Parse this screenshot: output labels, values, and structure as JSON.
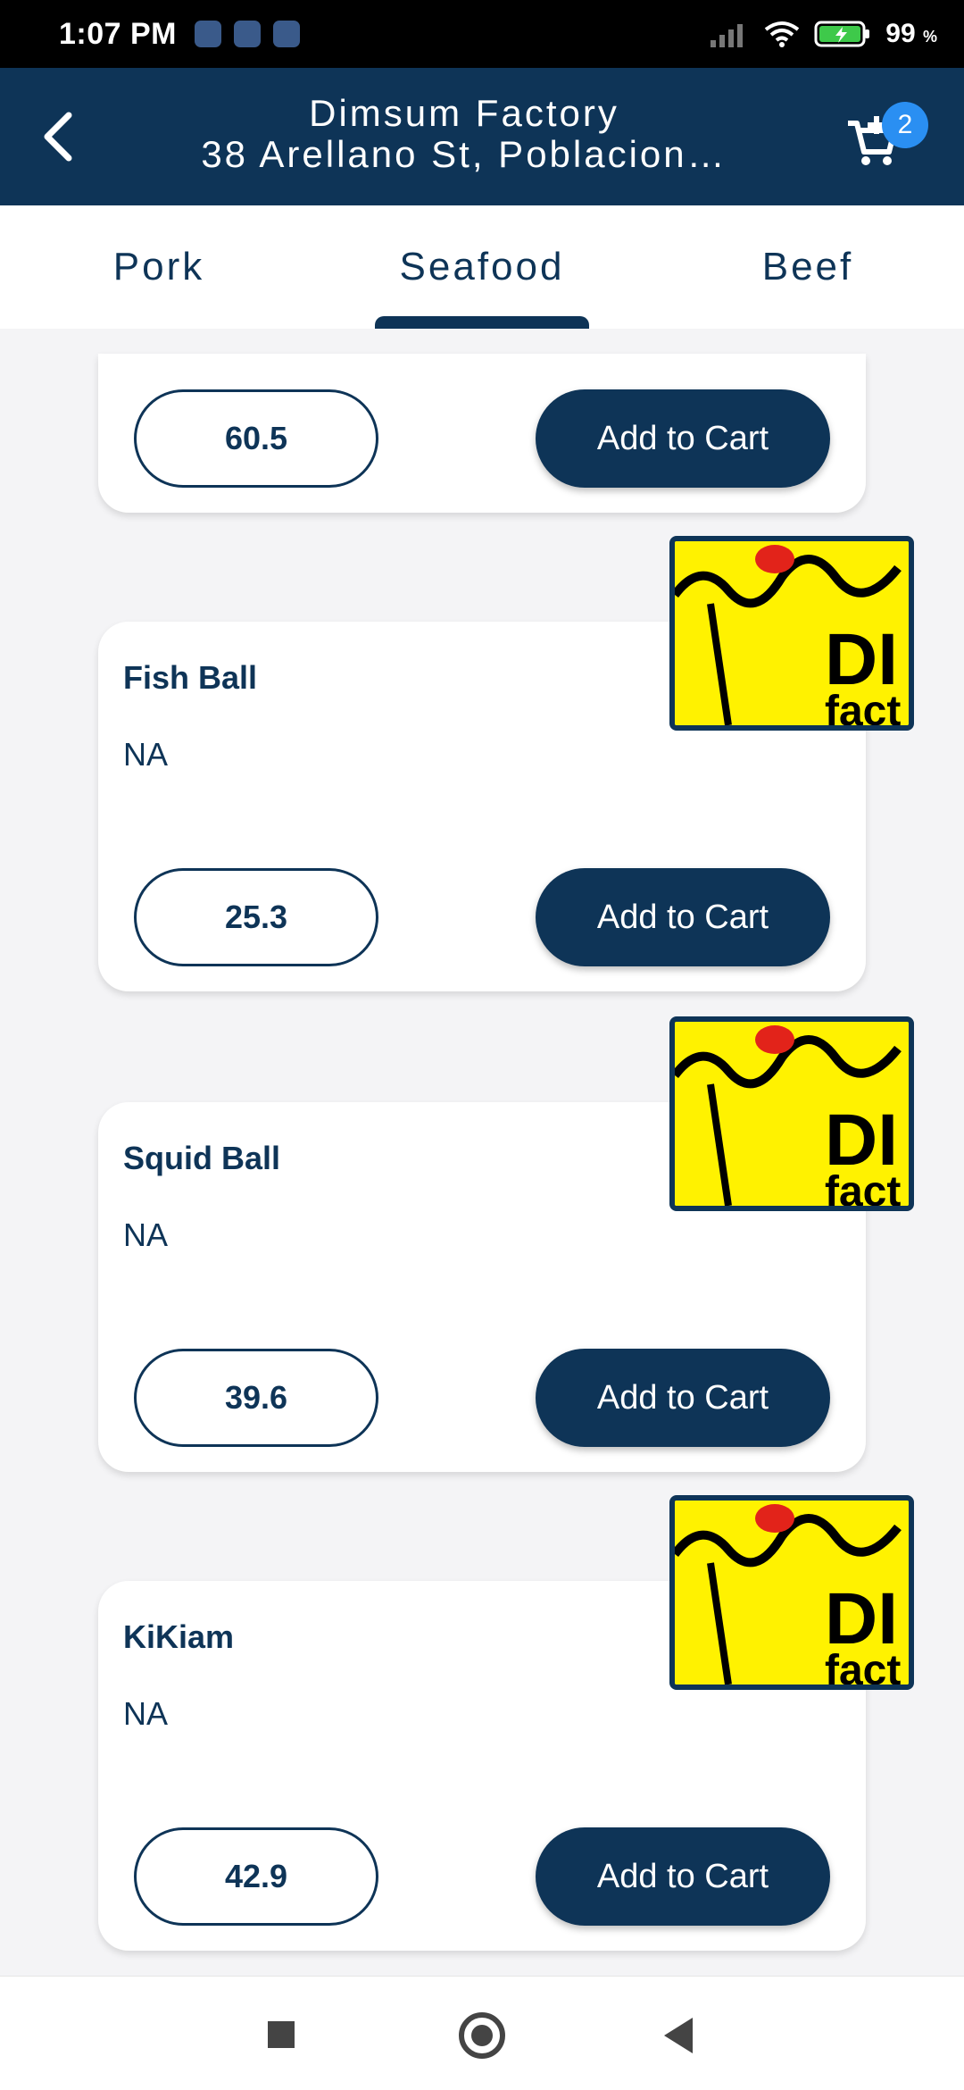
{
  "status": {
    "time": "1:07 PM",
    "battery": "99",
    "battery_unit": "%"
  },
  "header": {
    "title": "Dimsum Factory",
    "subtitle": "38 Arellano St, Poblacion…",
    "cart_count": "2",
    "icons": {
      "back": "back-arrow-icon",
      "cart": "cart-add-icon"
    }
  },
  "tabs": [
    {
      "label": "Pork",
      "selected": false
    },
    {
      "label": "Seafood",
      "selected": true
    },
    {
      "label": "Beef",
      "selected": false
    }
  ],
  "products": [
    {
      "name": "",
      "description": "",
      "price": "60.5",
      "button": "Add to Cart"
    },
    {
      "name": "Fish Ball",
      "description": "NA",
      "price": "25.3",
      "button": "Add to Cart"
    },
    {
      "name": "Squid Ball",
      "description": "NA",
      "price": "39.6",
      "button": "Add to Cart"
    },
    {
      "name": "KiKiam",
      "description": "NA",
      "price": "42.9",
      "button": "Add to Cart"
    }
  ],
  "logo_text": "DIMSUM factory",
  "colors": {
    "primary": "#0e3457",
    "badge": "#2a8ff2",
    "logo_bg": "#fff200"
  }
}
